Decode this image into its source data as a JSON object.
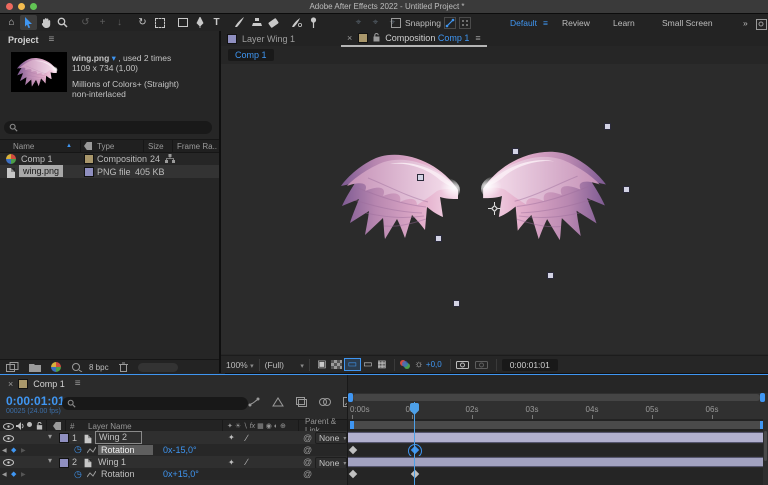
{
  "titlebar": {
    "title": "Adobe After Effects 2022 - Untitled Project *"
  },
  "toolbar": {
    "snapping_label": "Snapping",
    "workspaces": [
      "Default",
      "Review",
      "Learn",
      "Small Screen"
    ]
  },
  "glyphs": {
    "menu": "≡",
    "caret": "▾",
    "chevron": "▾",
    "close": "×",
    "overflow": "»",
    "home": "⌂",
    "rotate": "↻",
    "orbit": "↺",
    "pan": "+",
    "dolly": "↓",
    "type_tool": "T",
    "axis": "⌖",
    "pickwhip": "@",
    "kf_prev": "◀",
    "kf_next": "▶",
    "kf_diamond": "◆",
    "stopwatch": "◷",
    "sort_asc": "▲",
    "hash": "#",
    "quality": "∕",
    "anchor_sw": "✦",
    "sw_shy": "✦",
    "sw_sun": "☀",
    "sw_slash": "∖",
    "sw_fx": "fx",
    "sw_blend": "▦",
    "sw_mblur": "◉",
    "sw_adj": "◐",
    "sw_3d": "⊕",
    "preview_box": "▣",
    "roi": "▭",
    "guides": "▦",
    "gear": "☼"
  },
  "project_panel": {
    "tab": "Project",
    "info": {
      "name": "wing.png",
      "usage": ", used 2 times",
      "dims": "1109 x 734 (1,00)",
      "depth": "Millions of Colors+ (Straight)",
      "interlace": "non-interlaced"
    },
    "columns": {
      "name": "Name",
      "type": "Type",
      "size": "Size",
      "frame": "Frame Ra.."
    },
    "rows": [
      {
        "name": "Comp 1",
        "type": "Composition",
        "frame_rate": "24"
      },
      {
        "name": "wing.png",
        "type": "PNG file",
        "size": "405 KB"
      }
    ],
    "footer": {
      "bpc": "8 bpc"
    }
  },
  "comp_panel": {
    "tab_layer": "Layer Wing 1",
    "tab_comp_prefix": "Composition",
    "tab_comp_name": "Comp 1",
    "breadcrumb": "Comp 1",
    "bottom": {
      "zoom": "100%",
      "resolution": "(Full)",
      "exposure": "+0,0",
      "timecode": "0:00:01:01"
    }
  },
  "timeline": {
    "tab_name": "Comp 1",
    "timecode": "0:00:01:01",
    "frame_info": "00025 (24.00 fps)",
    "columns": {
      "layer_name": "Layer Name",
      "parent": "Parent & Link"
    },
    "layers": [
      {
        "index": "1",
        "name": "Wing 2",
        "parent": "None",
        "prop": "Rotation",
        "value": "0x-15,0°"
      },
      {
        "index": "2",
        "name": "Wing 1",
        "parent": "None",
        "prop": "Rotation",
        "value": "0x+15,0°"
      }
    ],
    "ruler": [
      "0:00s",
      "01s",
      "02s",
      "03s",
      "04s",
      "05s",
      "06s"
    ]
  },
  "colors": {
    "accent_blue": "#3f96f2",
    "label_comp": "#a9976b",
    "label_layer": "#8f8fc0",
    "render_green": "#15c315",
    "track_bar_selected": "#b1b0ce",
    "track_bar": "#a2a2c0"
  }
}
